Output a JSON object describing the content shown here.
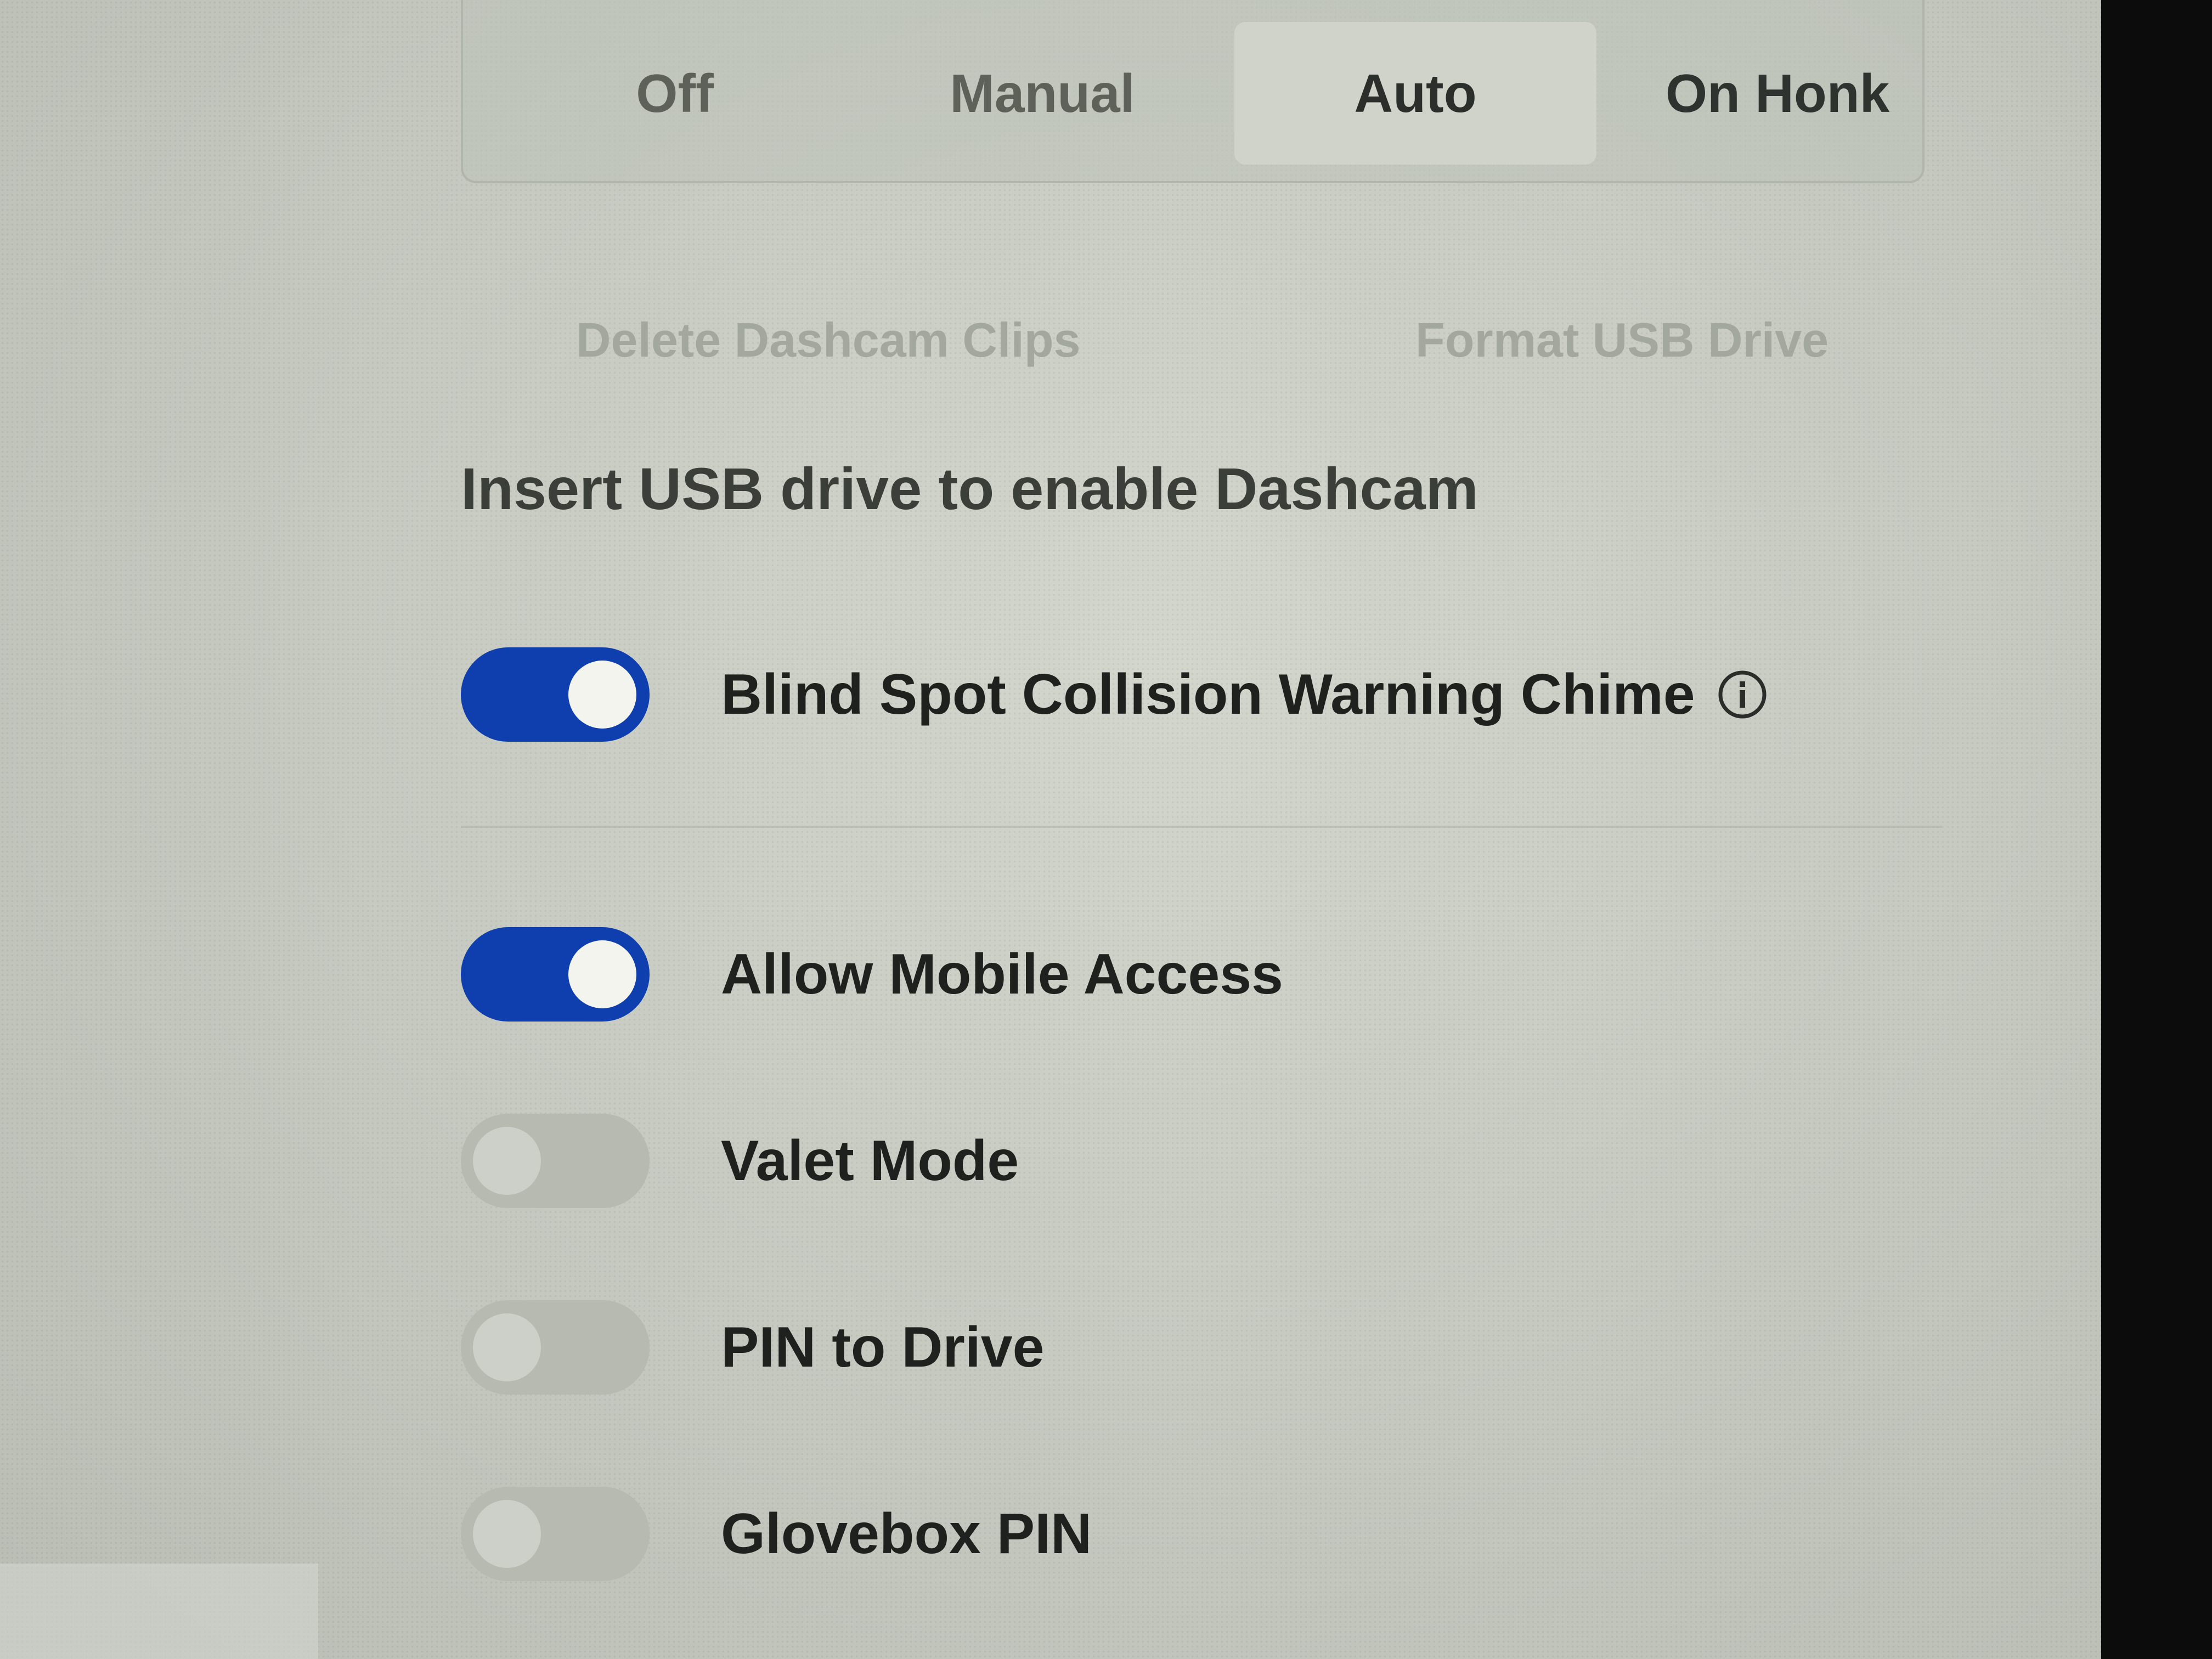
{
  "dashcam_mode": {
    "options": [
      "Off",
      "Manual",
      "Auto",
      "On Honk"
    ],
    "selected": "Auto"
  },
  "actions": {
    "delete_clips": "Delete Dashcam Clips",
    "format_usb": "Format USB Drive"
  },
  "notice": "Insert USB drive to enable Dashcam",
  "settings": [
    {
      "label": "Blind Spot Collision Warning Chime",
      "enabled": true,
      "has_info": true
    },
    {
      "label": "Allow Mobile Access",
      "enabled": true
    },
    {
      "label": "Valet Mode",
      "enabled": false
    },
    {
      "label": "PIN to Drive",
      "enabled": false
    },
    {
      "label": "Glovebox PIN",
      "enabled": false
    }
  ],
  "colors": {
    "toggle_on": "#0f3fae",
    "toggle_off": "#b6bab1",
    "text": "#1e211e",
    "disabled_text": "#a3a89f"
  },
  "icons": {
    "info": "info-icon"
  }
}
